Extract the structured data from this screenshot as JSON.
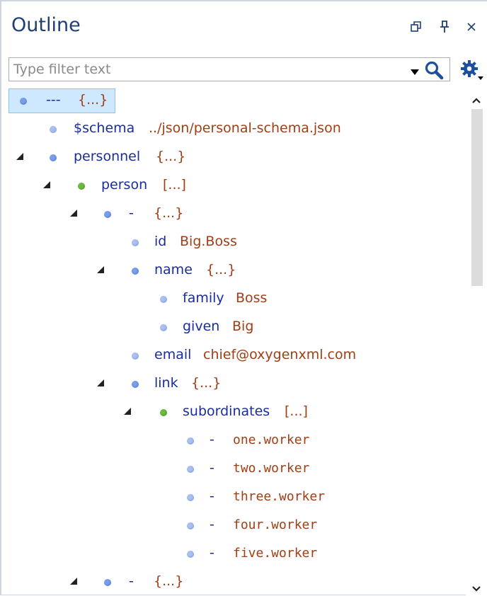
{
  "panel": {
    "title": "Outline",
    "buttons": {
      "restore_icon": "restore-window-icon",
      "pin_icon": "pin-icon",
      "close_icon": "close-icon"
    }
  },
  "filter": {
    "placeholder": "Type filter text",
    "value": "",
    "dropdown_icon": "dropdown-arrow-icon",
    "search_icon": "search-icon",
    "settings_icon": "settings-gear-icon"
  },
  "colors": {
    "key": "#1a2ba6",
    "value": "#a23e14",
    "selection": "#cde8ff",
    "node_blue": "#7a9ee8",
    "node_green": "#6cbb3c"
  },
  "tree": {
    "rows": [
      {
        "key": "---",
        "value": "{...}",
        "selected": true
      },
      {
        "key": "$schema",
        "value": "../json/personal-schema.json"
      },
      {
        "key": "personnel",
        "value": "{...}"
      },
      {
        "key": "person",
        "value": "[...]"
      },
      {
        "key": "-",
        "value": "{...}"
      },
      {
        "key": "id",
        "value": "Big.Boss"
      },
      {
        "key": "name",
        "value": "{...}"
      },
      {
        "key": "family",
        "value": "Boss"
      },
      {
        "key": "given",
        "value": "Big"
      },
      {
        "key": "email",
        "value": "chief@oxygenxml.com"
      },
      {
        "key": "link",
        "value": "{...}"
      },
      {
        "key": "subordinates",
        "value": "[...]"
      },
      {
        "key": "-",
        "value": "one.worker"
      },
      {
        "key": "-",
        "value": "two.worker"
      },
      {
        "key": "-",
        "value": "three.worker"
      },
      {
        "key": "-",
        "value": "four.worker"
      },
      {
        "key": "-",
        "value": "five.worker"
      },
      {
        "key": "-",
        "value": "{...}"
      }
    ]
  },
  "scrollbar": {
    "up_icon": "scroll-up-arrow-icon",
    "down_icon": "scroll-down-arrow-icon"
  }
}
